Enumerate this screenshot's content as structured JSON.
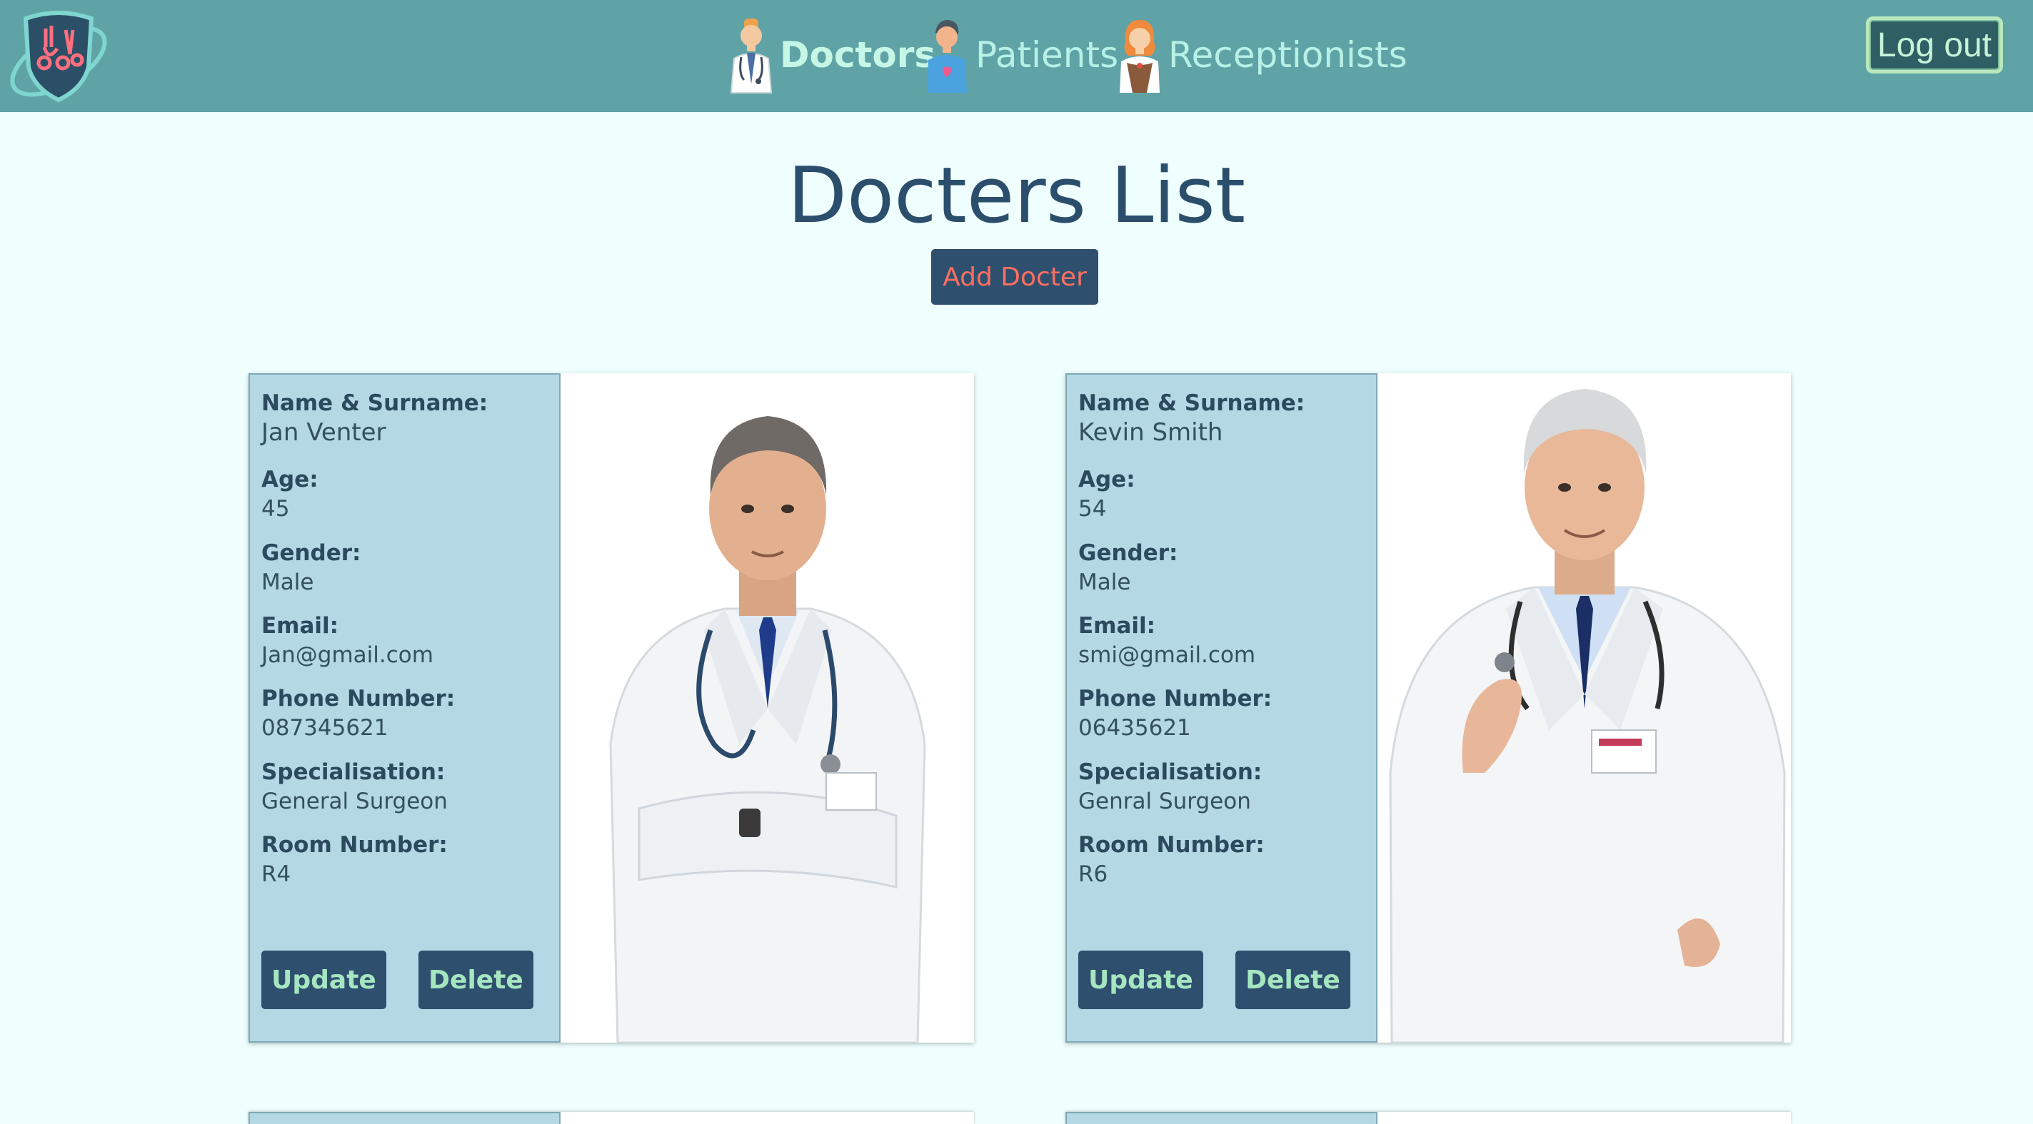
{
  "nav": {
    "items": [
      {
        "label": "Doctors",
        "icon": "doctor-avatar-icon",
        "active": true
      },
      {
        "label": "Patients",
        "icon": "patient-avatar-icon",
        "active": false
      },
      {
        "label": "Receptionists",
        "icon": "receptionist-avatar-icon",
        "active": false
      }
    ],
    "logout_label": "Log out"
  },
  "page": {
    "title": "Docters List",
    "add_button_label": "Add Docter"
  },
  "field_labels": {
    "name": "Name & Surname:",
    "age": "Age:",
    "gender": "Gender:",
    "email": "Email:",
    "phone": "Phone Number:",
    "specialisation": "Specialisation:",
    "room": "Room Number:"
  },
  "buttons": {
    "update": "Update",
    "delete": "Delete"
  },
  "doctors": [
    {
      "name": "Jan Venter",
      "age": "45",
      "gender": "Male",
      "email": "Jan@gmail.com",
      "phone": "087345621",
      "specialisation": "General Surgeon",
      "room": "R4"
    },
    {
      "name": "Kevin Smith",
      "age": "54",
      "gender": "Male",
      "email": "smi@gmail.com",
      "phone": "06435621",
      "specialisation": "Genral Surgeon",
      "room": "R6"
    }
  ],
  "colors": {
    "navbar": "#5fa3a6",
    "page_background": "#effffe",
    "button_background": "#2f4f6e",
    "card_info_background": "#b4d8e4",
    "title": "#2b4e6c"
  }
}
